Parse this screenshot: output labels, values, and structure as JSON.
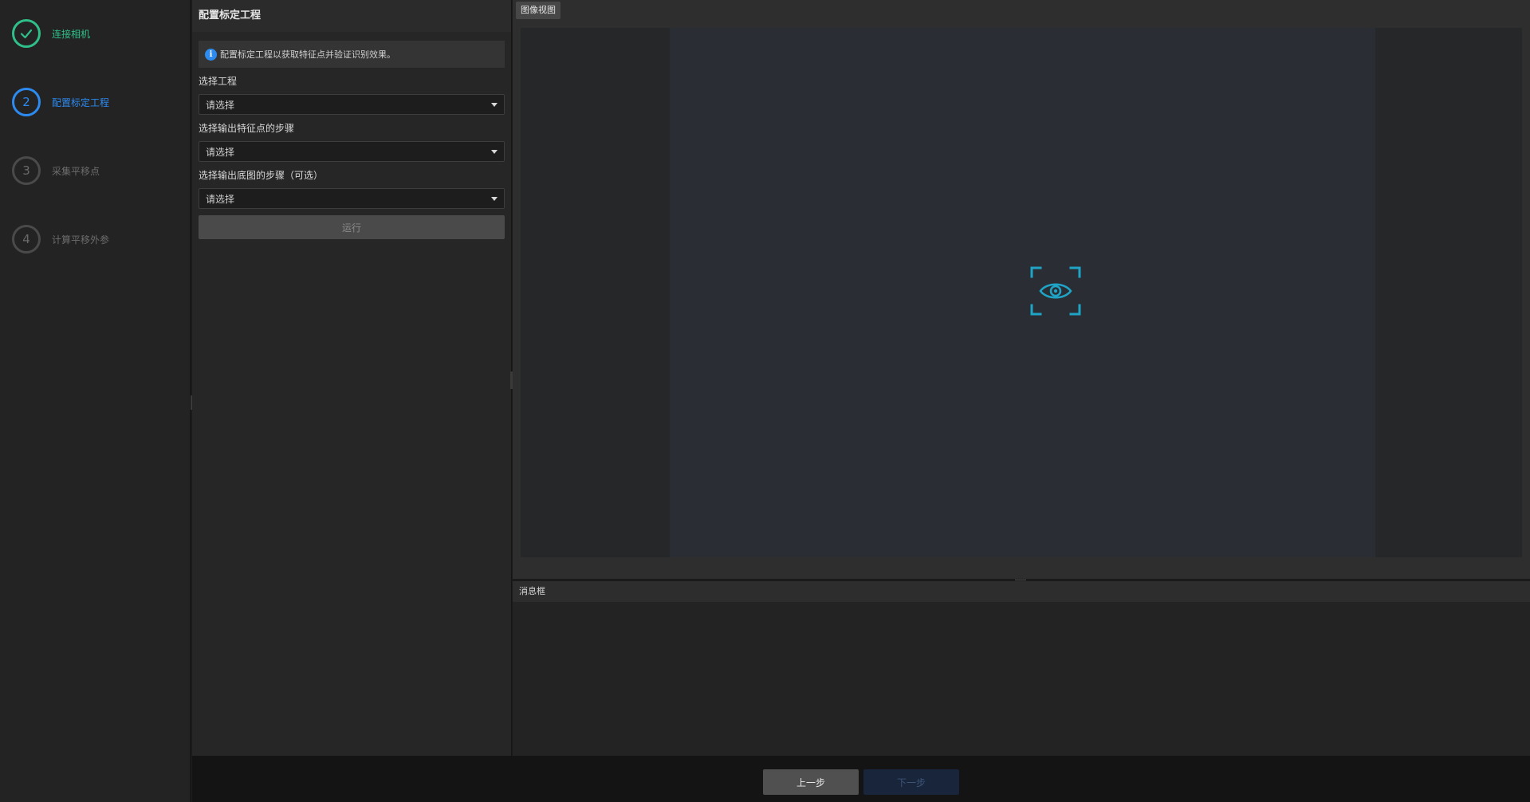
{
  "steps": [
    {
      "number": "1",
      "label": "连接相机",
      "state": "done"
    },
    {
      "number": "2",
      "label": "配置标定工程",
      "state": "active"
    },
    {
      "number": "3",
      "label": "采集平移点",
      "state": "pending"
    },
    {
      "number": "4",
      "label": "计算平移外参",
      "state": "pending"
    }
  ],
  "config": {
    "title": "配置标定工程",
    "info_icon": "i",
    "info_text": "配置标定工程以获取特征点并验证识别效果。",
    "fields": [
      {
        "label": "选择工程",
        "value": "请选择"
      },
      {
        "label": "选择输出特征点的步骤",
        "value": "请选择"
      },
      {
        "label": "选择输出底图的步骤（可选）",
        "value": "请选择"
      }
    ],
    "run_label": "运行"
  },
  "image_view": {
    "tab_label": "图像视图",
    "placeholder_icon": "eye-scan-icon",
    "accent_color": "#1fa3c6"
  },
  "messages": {
    "title": "消息框"
  },
  "footer": {
    "prev_label": "上一步",
    "next_label": "下一步"
  },
  "colors": {
    "done": "#2fc08a",
    "active": "#2d8bf0",
    "pending": "#4a4a4a"
  }
}
